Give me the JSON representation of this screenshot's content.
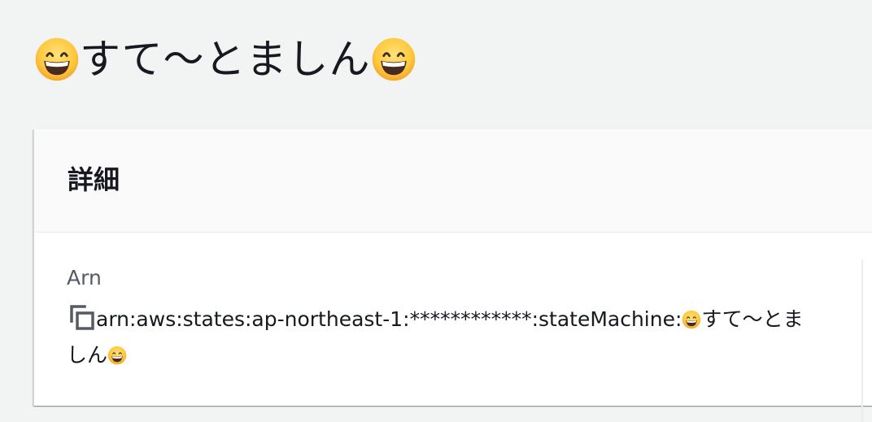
{
  "page": {
    "title_text": "すて〜とましん",
    "title_emoji_left": "smiling-face-with-big-eyes-emoji",
    "title_emoji_right": "smiling-face-with-big-eyes-emoji"
  },
  "details_panel": {
    "heading": "詳細",
    "fields": [
      {
        "label": "Arn",
        "value_prefix": "arn:aws:states:ap-northeast-1:************:stateMachine:",
        "value_middle": "すて〜とま",
        "value_suffix": "しん",
        "copy_icon": "copy-icon"
      }
    ]
  },
  "colors": {
    "page_background": "#f2f3f3",
    "panel_header_background": "#fafafa",
    "panel_background": "#ffffff",
    "text_primary": "#16191f",
    "text_secondary": "#545b64"
  }
}
